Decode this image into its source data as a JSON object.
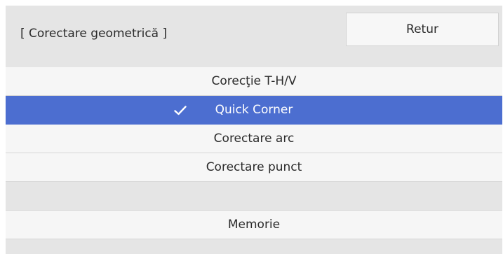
{
  "header": {
    "title": "[ Corectare geometrică ]",
    "back_label": "Retur"
  },
  "menu": {
    "items": [
      {
        "label": "Corecţie T-H/V",
        "selected": false
      },
      {
        "label": "Quick Corner",
        "selected": true,
        "icon": "checkmark-icon"
      },
      {
        "label": "Corectare arc",
        "selected": false
      },
      {
        "label": "Corectare punct",
        "selected": false
      }
    ],
    "memory_label": "Memorie"
  },
  "colors": {
    "selected_bg": "#4c6ed0",
    "panel_bg": "#e5e5e5",
    "item_bg": "#f6f6f6"
  }
}
